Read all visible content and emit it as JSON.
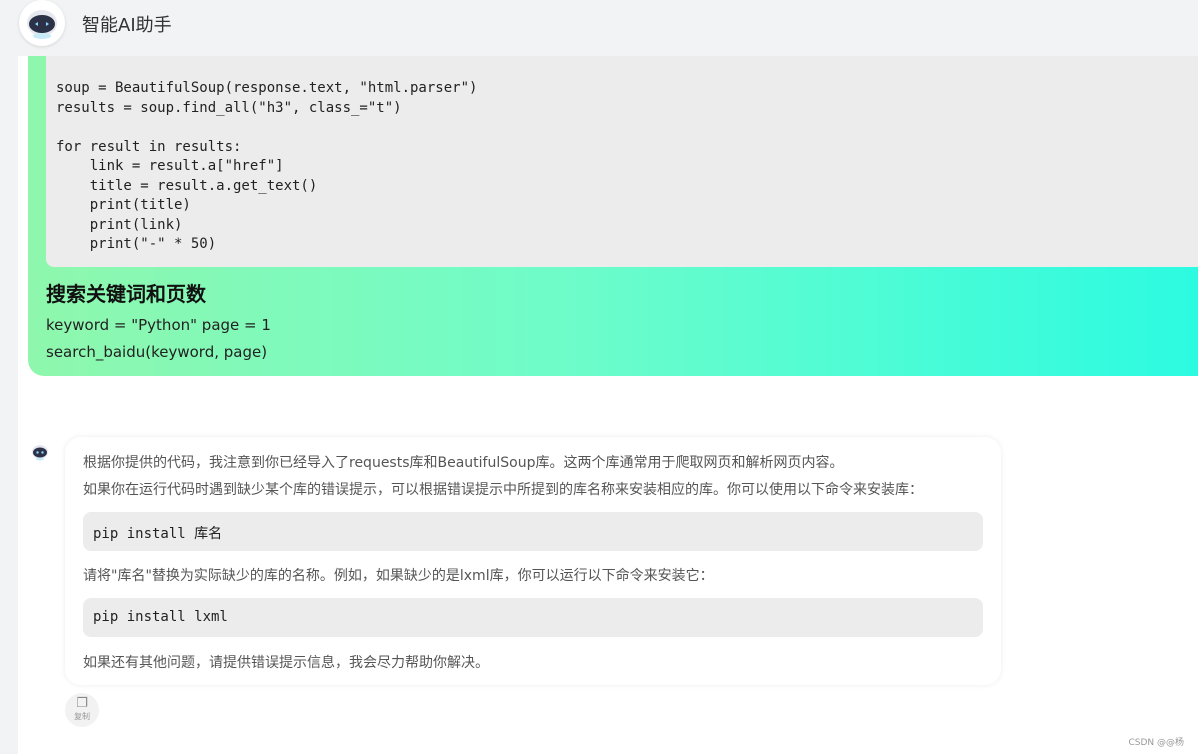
{
  "header": {
    "title": "智能AI助手",
    "logo_icon": "robot-icon"
  },
  "user_message": {
    "code": "soup = BeautifulSoup(response.text, \"html.parser\")\nresults = soup.find_all(\"h3\", class_=\"t\")\n\nfor result in results:\n    link = result.a[\"href\"]\n    title = result.a.get_text()\n    print(title)\n    print(link)\n    print(\"-\" * 50)",
    "heading": "搜索关键词和页数",
    "lines": [
      "keyword = \"Python\" page = 1",
      "search_baidu(keyword, page)"
    ]
  },
  "bot_message": {
    "avatar_icon": "robot-icon",
    "paragraph_1": "根据你提供的代码，我注意到你已经导入了requests库和BeautifulSoup库。这两个库通常用于爬取网页和解析网页内容。",
    "paragraph_2": "如果你在运行代码时遇到缺少某个库的错误提示，可以根据错误提示中所提到的库名称来安装相应的库。你可以使用以下命令来安装库：",
    "code_1": "pip install 库名",
    "paragraph_3": "请将\"库名\"替换为实际缺少的库的名称。例如，如果缺少的是lxml库，你可以运行以下命令来安装它：",
    "code_2": "pip install lxml",
    "paragraph_4": "如果还有其他问题，请提供错误提示信息，我会尽力帮助你解决。"
  },
  "copy_button": {
    "label": "复制",
    "icon": "copy-icon"
  },
  "watermark": "CSDN @@杨",
  "colors": {
    "gradient_start": "#8ff7ad",
    "gradient_end": "#2cfbe1",
    "code_bg": "#ececec",
    "page_bg": "#f1f3f4"
  }
}
